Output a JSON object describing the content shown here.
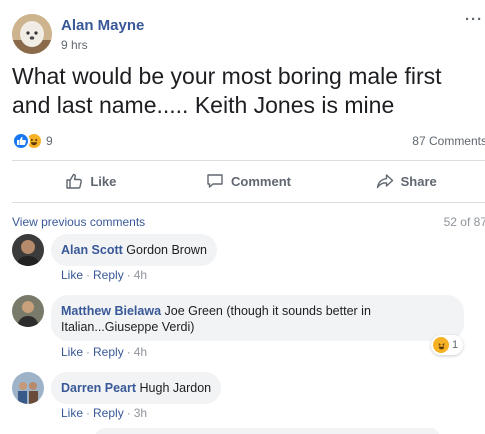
{
  "post": {
    "author": "Alan Mayne",
    "time": "9 hrs",
    "more_label": "···",
    "text": "What would be your most boring male first and last name..... Keith Jones is mine",
    "reaction_icons": [
      "like-icon",
      "haha-icon"
    ],
    "reaction_count": "9",
    "comment_count": "87 Comments"
  },
  "actions": {
    "like": "Like",
    "comment": "Comment",
    "share": "Share"
  },
  "comments_bar": {
    "view_previous": "View previous comments",
    "page_count": "52 of 87"
  },
  "comments": [
    {
      "author": "Alan Scott",
      "text": "Gordon Brown",
      "like": "Like",
      "reply": "Reply",
      "time": "4h"
    },
    {
      "author": "Matthew Bielawa",
      "text": "Joe Green (though it sounds better in Italian...Giuseppe Verdi)",
      "like": "Like",
      "reply": "Reply",
      "time": "4h",
      "reaction_icon": "haha-icon",
      "reaction_count": "1"
    },
    {
      "author": "Darren Peart",
      "text": "Hugh Jardon",
      "like": "Like",
      "reply": "Reply",
      "time": "3h"
    }
  ],
  "colors": {
    "link": "#385898",
    "like_blue": "#1877f2",
    "haha_yellow": "#f7b125",
    "bubble_bg": "#f2f3f5",
    "muted": "#606770"
  }
}
